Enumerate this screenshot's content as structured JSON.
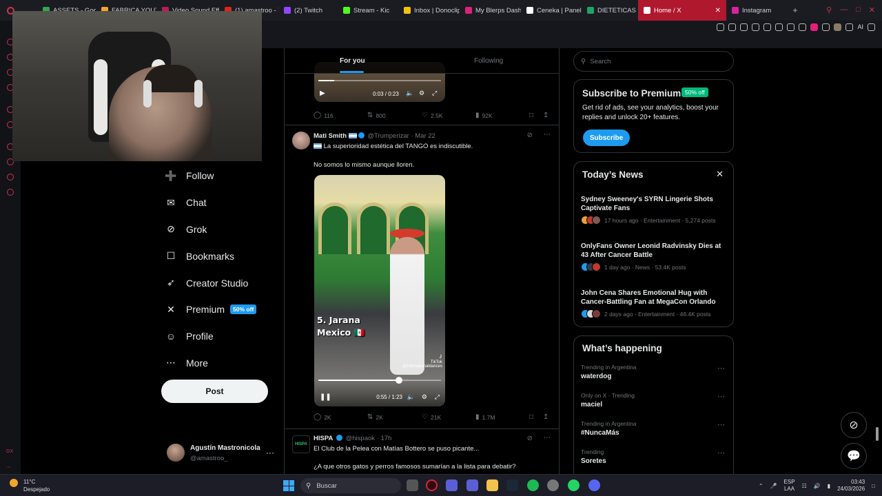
{
  "browser": {
    "tabs": [
      {
        "label": "ASSETS - Goog",
        "color": "#2fa84f"
      },
      {
        "label": "FABRICA YOUT",
        "color": "#f2a72b"
      },
      {
        "label": "Video Sound Eff",
        "color": "#c2185b"
      },
      {
        "label": "(1) amastroo - Y",
        "color": "#e62117"
      },
      {
        "label": "(2) Twitch",
        "color": "#9146ff"
      },
      {
        "label": "Stream - Kic",
        "color": "#53fc18"
      },
      {
        "label": "Inbox | Donoclip",
        "color": "#f4c20d"
      },
      {
        "label": "My Blerps Dashb",
        "color": "#e0207a"
      },
      {
        "label": "Ceneka | Panel",
        "color": "#ffffff"
      },
      {
        "label": "DIETETICAS DIS",
        "color": "#1fa463"
      },
      {
        "label": "Home / X",
        "color": "#ffffff"
      },
      {
        "label": "Instagram",
        "color": "#d6249f"
      }
    ],
    "active_tab_index": 10,
    "new_tab_symbol": "+",
    "ai_label": "AI"
  },
  "left_nav": {
    "items": [
      {
        "icon": "follow-icon",
        "glyph": "➕",
        "label": "Follow"
      },
      {
        "icon": "chat-icon",
        "glyph": "✉",
        "label": "Chat"
      },
      {
        "icon": "grok-icon",
        "glyph": "⊘",
        "label": "Grok"
      },
      {
        "icon": "bookmark-icon",
        "glyph": "☐",
        "label": "Bookmarks"
      },
      {
        "icon": "rocket-icon",
        "glyph": "➶",
        "label": "Creator Studio"
      },
      {
        "icon": "x-logo-icon",
        "glyph": "✕",
        "label": "Premium"
      },
      {
        "icon": "profile-icon",
        "glyph": "☺",
        "label": "Profile"
      },
      {
        "icon": "more-icon",
        "glyph": "⋯",
        "label": "More"
      }
    ],
    "premium_badge": "50% off",
    "post_label": "Post",
    "account": {
      "name": "Agustín Mastronicola",
      "handle": "@amastroo_",
      "menu": "···"
    }
  },
  "feed": {
    "tabs": {
      "for_you": "For you",
      "following": "Following"
    },
    "top_tweet": {
      "video_time": "0:03 / 0:23",
      "video_progress": 0.13,
      "stats": {
        "replies": "116",
        "reposts": "800",
        "likes": "2.5K",
        "views": "92K"
      }
    },
    "tweet1": {
      "name": "Mati Smith",
      "handle": "@Trumperizar",
      "date": "· Mar 22",
      "line1": "La superioridad estética del TANGO es indiscutible.",
      "line2": "No somos lo mismo aunque lloren.",
      "video_caption_1": "5. Jarana",
      "video_caption_2": "Mexico 🇲🇽",
      "tiktok_label": "TikTok",
      "tiktok_handle": "@internationaldances",
      "video_time": "0:55 / 1:23",
      "video_progress": 0.66,
      "stats": {
        "replies": "2K",
        "reposts": "2K",
        "likes": "21K",
        "views": "1.7M"
      }
    },
    "tweet2": {
      "name": "HISPA",
      "handle": "@hispaok",
      "date": "· 17h",
      "avatar_text": "HISPA",
      "line1": "El Club de la Pelea con Matías Bottero se puso picante...",
      "line2": "¿A que otros gatos y perros famosos sumarían a la lista para debatir?"
    }
  },
  "sidebar": {
    "search_placeholder": "Search",
    "premium": {
      "title": "Subscribe to Premium",
      "badge": "50% off",
      "body": "Get rid of ads, see your analytics, boost your replies and unlock 20+ features.",
      "button": "Subscribe"
    },
    "news": {
      "title": "Today’s News",
      "items": [
        {
          "title": "Sydney Sweeney's SYRN Lingerie Shots Captivate Fans",
          "meta": "17 hours ago · Entertainment · 5,274 posts"
        },
        {
          "title": "OnlyFans Owner Leonid Radvinsky Dies at 43 After Cancer Battle",
          "meta": "1 day ago · News · 53.4K posts"
        },
        {
          "title": "John Cena Shares Emotional Hug with Cancer-Battling Fan at MegaCon Orlando",
          "meta": "2 days ago · Entertainment · 46.4K posts"
        }
      ]
    },
    "happening": {
      "title": "What’s happening",
      "items": [
        {
          "context": "Trending in Argentina",
          "name": "waterdog"
        },
        {
          "context": "Only on X · Trending",
          "name": "maciel"
        },
        {
          "context": "Trending in Argentina",
          "name": "#NuncaMás"
        },
        {
          "context": "Trending",
          "name": "Soretes"
        }
      ]
    }
  },
  "taskbar": {
    "temperature": "11°C",
    "weather": "Despejado",
    "search_label": "Buscar",
    "lang_1": "ESP",
    "lang_2": "LAA",
    "time": "03:43",
    "date": "24/03/2026"
  },
  "colors": {
    "accent": "#1d9bf0",
    "active_tab": "#b0182e",
    "premium_green": "#00ba7c"
  }
}
